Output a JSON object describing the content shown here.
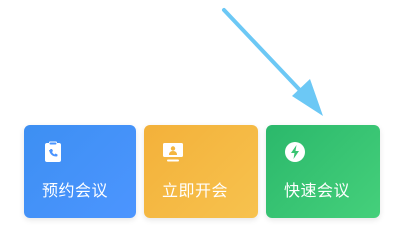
{
  "tiles": [
    {
      "label": "预约会议",
      "icon": "clipboard-phone-icon",
      "color": "#4a94ff"
    },
    {
      "label": "立即开会",
      "icon": "monitor-person-icon",
      "color": "#f4b63f"
    },
    {
      "label": "快速会议",
      "icon": "lightning-bolt-icon",
      "color": "#39c472"
    }
  ],
  "annotation": {
    "arrow_color": "#6cc8f5"
  }
}
